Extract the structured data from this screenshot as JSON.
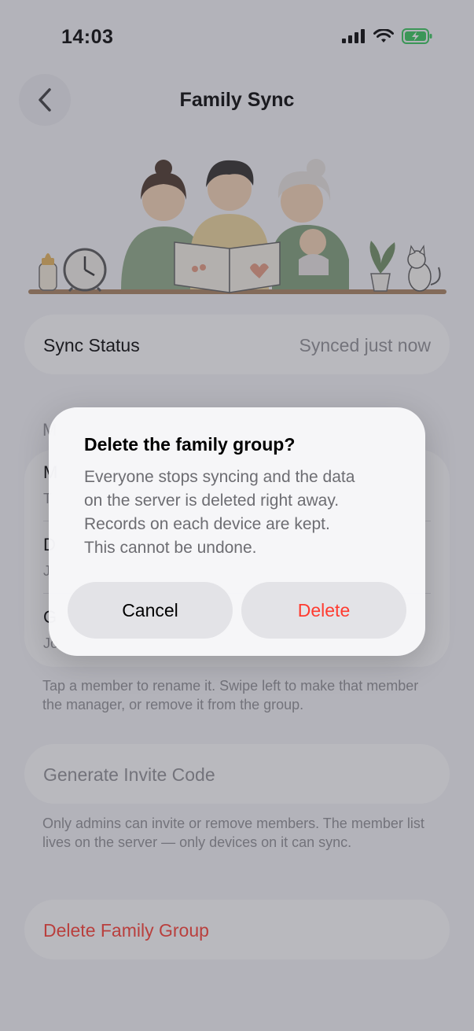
{
  "status_bar": {
    "time": "14:03"
  },
  "nav": {
    "title": "Family Sync"
  },
  "sync": {
    "label": "Sync Status",
    "value": "Synced just now"
  },
  "members": {
    "header": "M",
    "items": [
      {
        "name": "M",
        "sub": "T"
      },
      {
        "name": "D",
        "sub": "J"
      },
      {
        "name": "G",
        "sub": "Jo"
      }
    ],
    "footnote": "Tap a member to rename it. Swipe left to make that member the manager, or remove it from the group."
  },
  "invite": {
    "label": "Generate Invite Code",
    "footnote": "Only admins can invite or remove members. The member list lives on the server — only devices on it can sync."
  },
  "danger": {
    "label": "Delete Family Group"
  },
  "alert": {
    "title": "Delete the family group?",
    "message_lines": [
      "Everyone stops syncing and the data",
      "on the server is deleted right away.",
      "Records on each device are kept.",
      "This cannot be undone."
    ],
    "cancel": "Cancel",
    "delete": "Delete"
  },
  "colors": {
    "destructive": "#ff3b30",
    "secondary_text": "#8e8e93",
    "background": "#f6f6f8"
  }
}
